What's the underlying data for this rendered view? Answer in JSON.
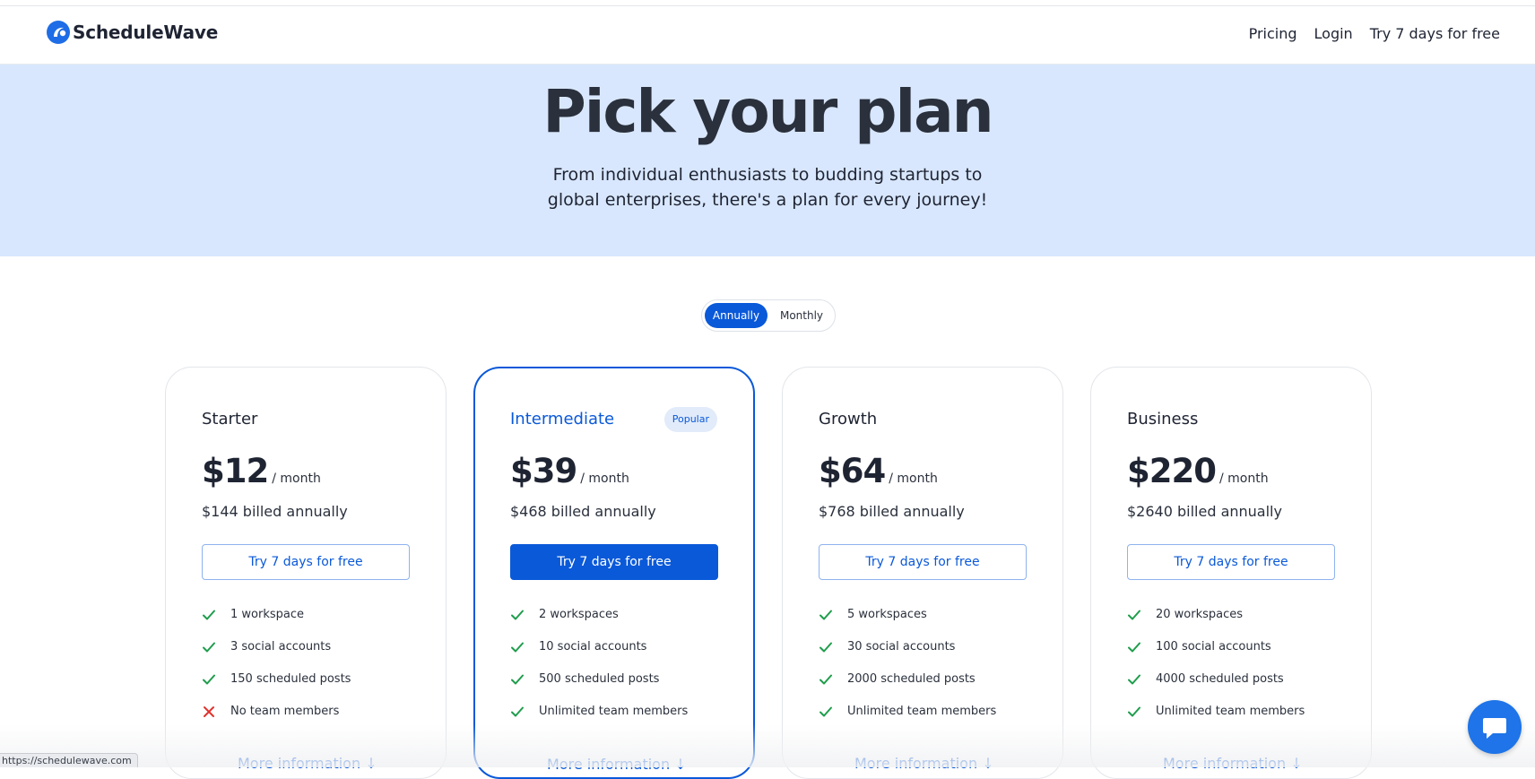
{
  "nav": {
    "brand": "ScheduleWave",
    "links": [
      "Pricing",
      "Login",
      "Try 7 days for free"
    ]
  },
  "hero": {
    "title": "Pick your plan",
    "subtitle": "From individual enthusiasts to budding startups to global enterprises, there's a plan for every journey!"
  },
  "billing_toggle": {
    "annual": "Annually",
    "monthly": "Monthly",
    "selected": "Annually"
  },
  "plans": [
    {
      "name": "Starter",
      "price": "$12",
      "per": "/ month",
      "billed": "$144 billed annually",
      "cta": "Try 7 days for free",
      "badge": "",
      "features": [
        {
          "text": "1 workspace",
          "included": true
        },
        {
          "text": "3 social accounts",
          "included": true
        },
        {
          "text": "150 scheduled posts",
          "included": true
        },
        {
          "text": "No team members",
          "included": false
        }
      ],
      "more": "More information"
    },
    {
      "name": "Intermediate",
      "price": "$39",
      "per": "/ month",
      "billed": "$468 billed annually",
      "cta": "Try 7 days for free",
      "badge": "Popular",
      "features": [
        {
          "text": "2 workspaces",
          "included": true
        },
        {
          "text": "10 social accounts",
          "included": true
        },
        {
          "text": "500 scheduled posts",
          "included": true
        },
        {
          "text": "Unlimited team members",
          "included": true
        }
      ],
      "more": "More information"
    },
    {
      "name": "Growth",
      "price": "$64",
      "per": "/ month",
      "billed": "$768 billed annually",
      "cta": "Try 7 days for free",
      "badge": "",
      "features": [
        {
          "text": "5 workspaces",
          "included": true
        },
        {
          "text": "30 social accounts",
          "included": true
        },
        {
          "text": "2000 scheduled posts",
          "included": true
        },
        {
          "text": "Unlimited team members",
          "included": true
        }
      ],
      "more": "More information"
    },
    {
      "name": "Business",
      "price": "$220",
      "per": "/ month",
      "billed": "$2640 billed annually",
      "cta": "Try 7 days for free",
      "badge": "",
      "features": [
        {
          "text": "20 workspaces",
          "included": true
        },
        {
          "text": "100 social accounts",
          "included": true
        },
        {
          "text": "4000 scheduled posts",
          "included": true
        },
        {
          "text": "Unlimited team members",
          "included": true
        }
      ],
      "more": "More information"
    }
  ],
  "status_url": "https://schedulewave.com",
  "icons": {
    "brand": "wave-logo-icon",
    "included": "check-icon",
    "excluded": "x-icon",
    "more": "arrow-down-icon",
    "chat": "chat-bubble-icon"
  },
  "colors": {
    "accent": "#0a59d9",
    "hero_bg": "#d8e7fd",
    "check": "#1f9d4c",
    "cross": "#e0332f"
  }
}
